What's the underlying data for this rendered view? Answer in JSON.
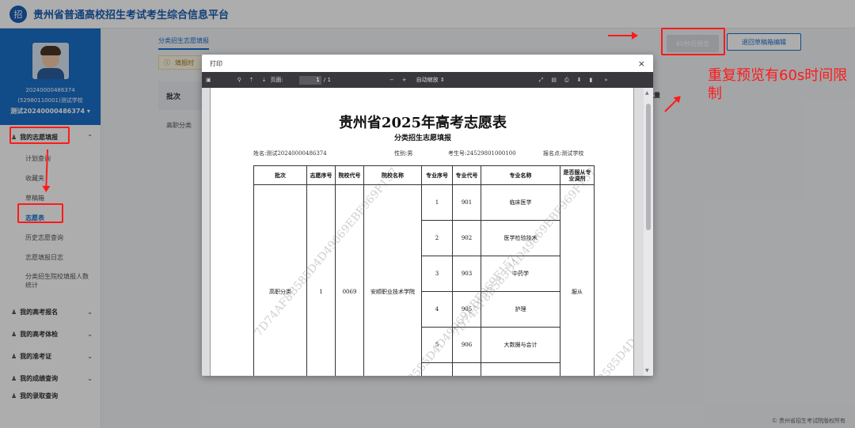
{
  "app": {
    "title": "贵州省普通高校招生考试考生综合信息平台",
    "logo_text": "招",
    "footer": "© 贵州省招生考试院版权所有"
  },
  "profile": {
    "id": "20240000486374",
    "school": "(52980110001)测试学校",
    "name": "测试20240000486374 ▾"
  },
  "sidebar": {
    "volunteer_group": "我的志愿填报",
    "volunteer_items": [
      "计划查询",
      "收藏夹",
      "草稿箱",
      "志愿表",
      "历史志愿查询",
      "志愿填报日志",
      "分类招生院校填报人数统计"
    ],
    "other_groups": [
      "我的高考报名",
      "我的高考体检",
      "我的准考证",
      "我的成绩查询",
      "我的录取查询"
    ]
  },
  "main": {
    "tab": "分类招生志愿填报",
    "tip": "填报时",
    "table_header": "批次",
    "row_batch": "高职分类",
    "right_header": "数量",
    "preview_button": "60秒后预览",
    "back_button": "退回草稿箱编辑"
  },
  "annotation": {
    "note": "重复预览有60s时间限制"
  },
  "dialog": {
    "title": "打印",
    "close": "×",
    "toolbar": {
      "page_label": "页面:",
      "page_value": "1",
      "page_total": "/ 1",
      "zoom": "自动缩放"
    },
    "doc": {
      "title": "贵州省2025年高考志愿表",
      "subtitle": "分类招生志愿填报",
      "name": "姓名:测试20240000486374",
      "gender": "性别:男",
      "exam_no": "考生号:24529801000100",
      "site": "报名点:测试学校",
      "headers": [
        "批次",
        "志愿序号",
        "院校代号",
        "院校名称",
        "专业序号",
        "专业代号",
        "专业名称",
        "是否服从专业调剂"
      ],
      "batch": "高职分类",
      "volunteer_no": "1",
      "school_code": "0069",
      "school_name": "安顺职业技术学院",
      "majors": [
        {
          "seq": "1",
          "code": "901",
          "name": "临床医学"
        },
        {
          "seq": "2",
          "code": "902",
          "name": "医学检验技术"
        },
        {
          "seq": "3",
          "code": "903",
          "name": "中药学"
        },
        {
          "seq": "4",
          "code": "905",
          "name": "护理"
        },
        {
          "seq": "5",
          "code": "906",
          "name": "大数据与会计"
        }
      ],
      "adjust": "服从",
      "watermark": "7D74AF8B585D4D49069EBF969F157"
    }
  },
  "colors": {
    "brand": "#1a6fc9",
    "annotation": "#ff1a1a"
  }
}
